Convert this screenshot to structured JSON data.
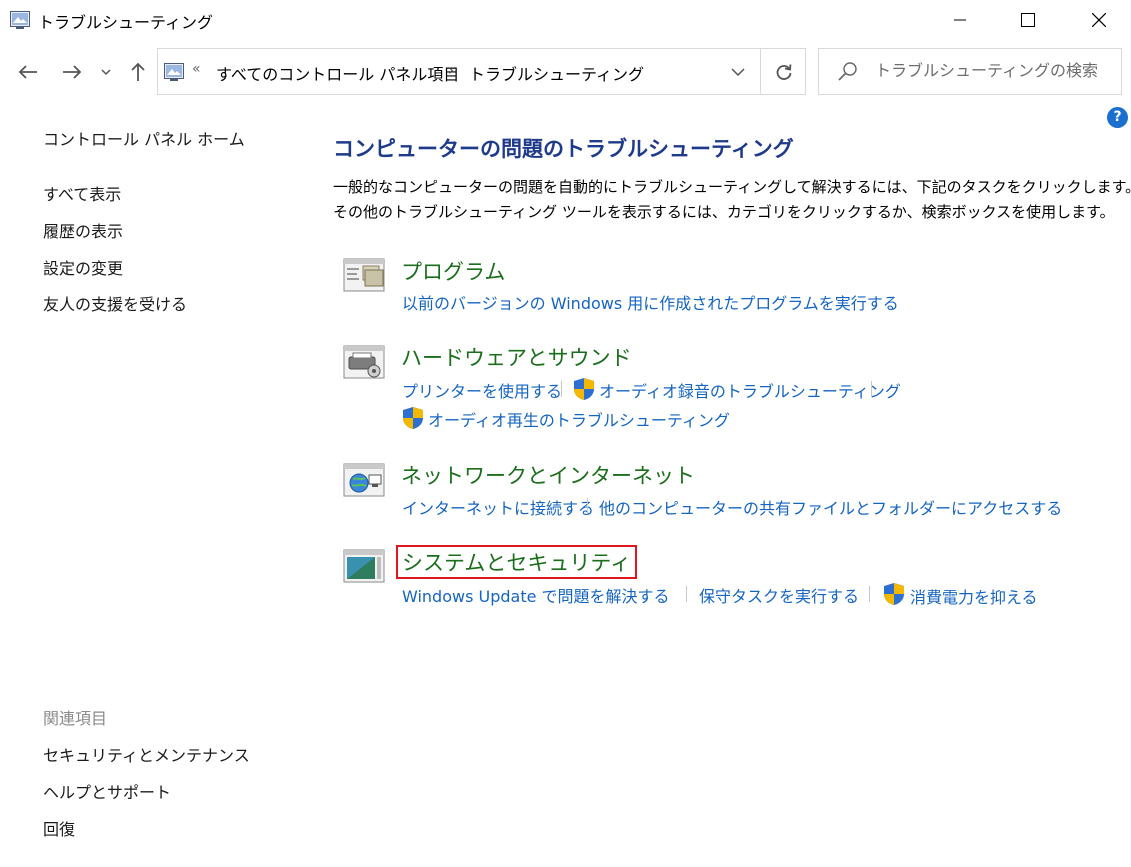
{
  "window": {
    "title": "トラブルシューティング"
  },
  "address_bar": {
    "overflow": "«",
    "crumbs": [
      "すべてのコントロール パネル項目",
      "トラブルシューティング"
    ],
    "separator": "›"
  },
  "search": {
    "placeholder": "トラブルシューティングの検索"
  },
  "help": {
    "label": "?"
  },
  "sidebar": {
    "home": "コントロール パネル ホーム",
    "items": [
      "すべて表示",
      "履歴の表示",
      "設定の変更",
      "友人の支援を受ける"
    ],
    "related_heading": "関連項目",
    "related": [
      "セキュリティとメンテナンス",
      "ヘルプとサポート",
      "回復"
    ]
  },
  "main": {
    "title": "コンピューターの問題のトラブルシューティング",
    "description": [
      "一般的なコンピューターの問題を自動的にトラブルシューティングして解決するには、下記のタスクをクリックします。",
      "その他のトラブルシューティング ツールを表示するには、カテゴリをクリックするか、検索ボックスを使用します。"
    ],
    "categories": [
      {
        "title": "プログラム",
        "tasks": [
          "以前のバージョンの Windows 用に作成されたプログラムを実行する"
        ]
      },
      {
        "title": "ハードウェアとサウンド",
        "tasks": [
          "プリンターを使用する",
          "オーディオ録音のトラブルシューティング",
          "オーディオ再生のトラブルシューティング"
        ]
      },
      {
        "title": "ネットワークとインターネット",
        "tasks": [
          "インターネットに接続する",
          "他のコンピューターの共有ファイルとフォルダーにアクセスする"
        ]
      },
      {
        "title": "システムとセキュリティ",
        "tasks": [
          "Windows Update で問題を解決する",
          "保守タスクを実行する",
          "消費電力を抑える"
        ]
      }
    ]
  },
  "colors": {
    "heading_blue": "#1e3a8a",
    "category_green": "#1b6e1b",
    "link_blue": "#1565c0",
    "highlight_red": "#e0171e",
    "help_blue": "#1a6fd0"
  }
}
